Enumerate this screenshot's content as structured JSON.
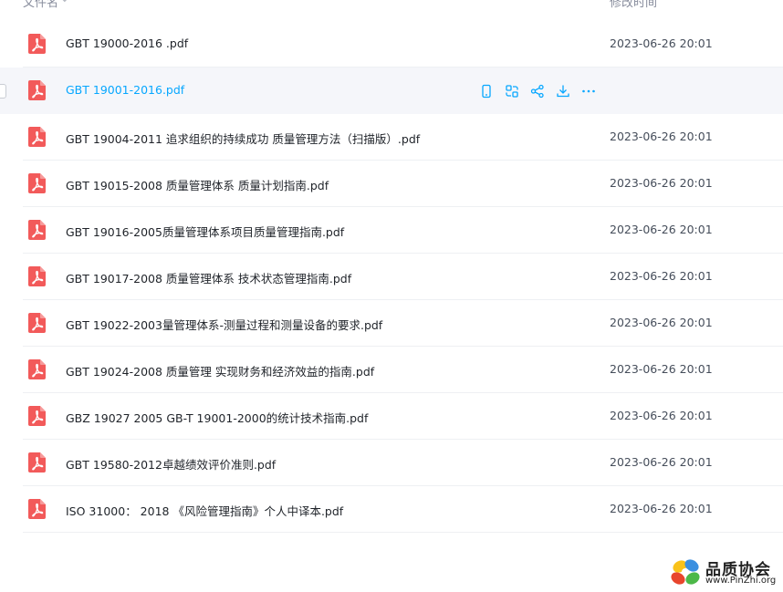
{
  "header": {
    "name_label": "文件名",
    "time_label": "修改时间"
  },
  "files": [
    {
      "name": "GBT 19000-2016 .pdf",
      "time": "2023-06-26 20:01"
    },
    {
      "name": "GBT 19001-2016.pdf",
      "time": ""
    },
    {
      "name": "GBT 19004-2011 追求组织的持续成功 质量管理方法（扫描版）.pdf",
      "time": "2023-06-26 20:01"
    },
    {
      "name": "GBT 19015-2008 质量管理体系 质量计划指南.pdf",
      "time": "2023-06-26 20:01"
    },
    {
      "name": "GBT 19016-2005质量管理体系项目质量管理指南.pdf",
      "time": "2023-06-26 20:01"
    },
    {
      "name": "GBT 19017-2008 质量管理体系 技术状态管理指南.pdf",
      "time": "2023-06-26 20:01"
    },
    {
      "name": "GBT 19022-2003量管理体系-测量过程和测量设备的要求.pdf",
      "time": "2023-06-26 20:01"
    },
    {
      "name": "GBT 19024-2008 质量管理 实现财务和经济效益的指南.pdf",
      "time": "2023-06-26 20:01"
    },
    {
      "name": "GBZ 19027 2005 GB-T 19001-2000的统计技术指南.pdf",
      "time": "2023-06-26 20:01"
    },
    {
      "name": "GBT 19580-2012卓越绩效评价准则.pdf",
      "time": "2023-06-26 20:01"
    },
    {
      "name": "ISO 31000： 2018 《风险管理指南》个人中译本.pdf",
      "time": "2023-06-26 20:01"
    }
  ],
  "hover_actions": [
    "phone-icon",
    "scan-icon",
    "share-icon",
    "download-icon",
    "more-icon"
  ],
  "watermark": {
    "title": "品质协会",
    "url": "www.PinZhi.org"
  },
  "colors": {
    "accent": "#06a7ff",
    "pdf_icon": "#f25a5a",
    "hover_bg": "#f5f6fa"
  }
}
